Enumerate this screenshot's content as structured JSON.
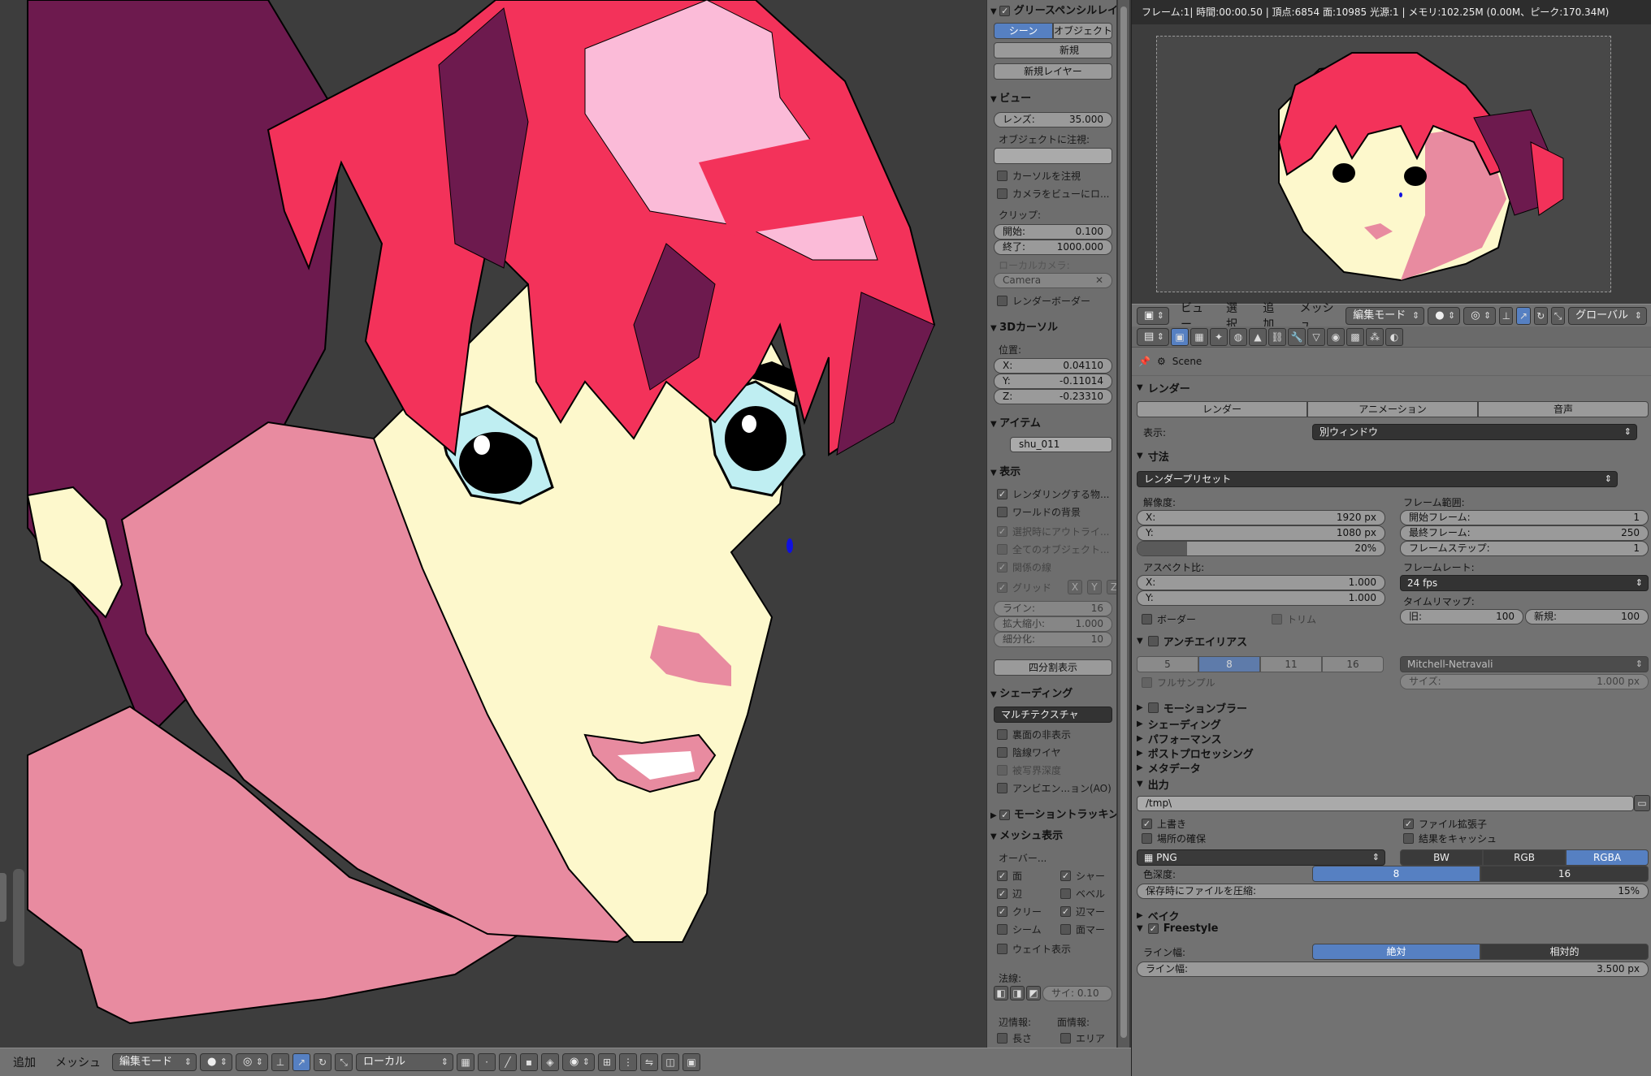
{
  "viewport": {
    "header": {
      "menus": [
        "追加",
        "メッシュ"
      ],
      "mode": "編集モード",
      "pivot": "ローカル"
    }
  },
  "npanel": {
    "grease": {
      "title": "グリースペンシルレイ",
      "scene": "シーン",
      "object": "オブジェクト",
      "new": "新規",
      "new_layer": "新規レイヤー"
    },
    "view": {
      "title": "ビュー",
      "lens_label": "レンズ:",
      "lens": "35.000",
      "lock_obj": "オブジェクトに注視:",
      "lock_cursor": "カーソルを注視",
      "lock_camera": "カメラをビューにロ...",
      "clip": "クリップ:",
      "start_label": "開始:",
      "start": "0.100",
      "end_label": "終了:",
      "end": "1000.000",
      "local_camera": "ローカルカメラ:",
      "camera": "Camera",
      "render_border": "レンダーボーダー"
    },
    "cursor": {
      "title": "3Dカーソル",
      "location": "位置:",
      "x_label": "X:",
      "x": "0.04110",
      "y_label": "Y:",
      "y": "-0.11014",
      "z_label": "Z:",
      "z": "-0.23310"
    },
    "item": {
      "title": "アイテム",
      "name": "shu_011"
    },
    "display": {
      "title": "表示",
      "only_render": "レンダリングする物...",
      "world_bg": "ワールドの背景",
      "outline": "選択時にアウトライ...",
      "all_edges": "全てのオブジェクト...",
      "relations": "関係の線",
      "grid": "グリッド",
      "gx": "X",
      "gy": "Y",
      "gz": "Z",
      "lines_label": "ライン:",
      "lines": "16",
      "scale_label": "拡大縮小:",
      "scale": "1.000",
      "subdiv_label": "細分化:",
      "subdiv": "10",
      "quad": "四分割表示"
    },
    "shading": {
      "title": "シェーディング",
      "mode": "マルチテクスチャ",
      "backface": "裏面の非表示",
      "hidden_wire": "陰線ワイヤ",
      "dof": "被写界深度",
      "ao": "アンビエン...ョン(AO)"
    },
    "tracking": {
      "title": "モーショントラッキン"
    },
    "mesh_display": {
      "title": "メッシュ表示",
      "overlay": "オーバー...",
      "faces": "面",
      "sharp": "シャー",
      "edges": "辺",
      "bevel": "ベベル",
      "crease": "クリー",
      "edge_marks": "辺マー",
      "seams": "シーム",
      "face_marks": "面マー",
      "weight": "ウェイト表示",
      "normals": "法線:",
      "normal_size": "サイ: 0.10",
      "edge_info": "辺情報:",
      "face_info": "面情報:",
      "length": "長さ",
      "area": "エリア"
    }
  },
  "render_window": {
    "info": "フレーム:1| 時間:00:00.50 | 頂点:6854 面:10985 光源:1 | メモリ:102.25M (0.00M、ピーク:170.34M)",
    "header": {
      "menus": [
        "ビュー",
        "選択",
        "追加",
        "メッシュ"
      ],
      "mode": "編集モード",
      "orientation": "グローバル"
    }
  },
  "properties": {
    "scene": "Scene",
    "render": {
      "title": "レンダー",
      "render_btn": "レンダー",
      "anim_btn": "アニメーション",
      "audio_btn": "音声",
      "display_label": "表示:",
      "display": "別ウィンドウ"
    },
    "dimensions": {
      "title": "寸法",
      "preset": "レンダープリセット",
      "resolution": "解像度:",
      "x_label": "X:",
      "x": "1920 px",
      "y_label": "Y:",
      "y": "1080 px",
      "percent": "20%",
      "percent_value": 20,
      "aspect": "アスペクト比:",
      "ax": "1.000",
      "ay": "1.000",
      "frame_range": "フレーム範囲:",
      "start_label": "開始フレーム:",
      "start": "1",
      "end_label": "最終フレーム:",
      "end": "250",
      "step_label": "フレームステップ:",
      "step": "1",
      "frame_rate": "フレームレート:",
      "fps": "24 fps",
      "time_remap": "タイムリマップ:",
      "old_label": "旧:",
      "old": "100",
      "new_label": "新規:",
      "new": "100",
      "border": "ボーダー",
      "crop": "トリム"
    },
    "aa": {
      "title": "アンチエイリアス",
      "samples": [
        "5",
        "8",
        "11",
        "16"
      ],
      "filter": "Mitchell-Netravali",
      "full_sample": "フルサンプル",
      "size_label": "サイズ:",
      "size": "1.000 px"
    },
    "collapsed": [
      "シェーディング",
      "パフォーマンス",
      "ポストプロセッシング",
      "メタデータ"
    ],
    "motion_blur": "モーションブラー",
    "output": {
      "title": "出力",
      "path": "/tmp\\",
      "overwrite": "上書き",
      "placeholders": "場所の確保",
      "extension": "ファイル拡張子",
      "cache": "結果をキャッシュ",
      "format": "PNG",
      "bw": "BW",
      "rgb": "RGB",
      "rgba": "RGBA",
      "depth_label": "色深度:",
      "d8": "8",
      "d16": "16",
      "compress_label": "保存時にファイルを圧縮:",
      "compress": "15%"
    },
    "bake": "ベイク",
    "freestyle": {
      "title": "Freestyle",
      "line_width_mode": "ライン幅:",
      "absolute": "絶対",
      "relative": "相対的",
      "line_width_label": "ライン幅:",
      "line_width": "3.500 px"
    }
  },
  "colors": {
    "hair": "#f3325a",
    "hair_dark": "#6d1a4e",
    "skin_light": "#fdf8cc",
    "skin": "#e88ba0",
    "accent": "#5680c2"
  }
}
